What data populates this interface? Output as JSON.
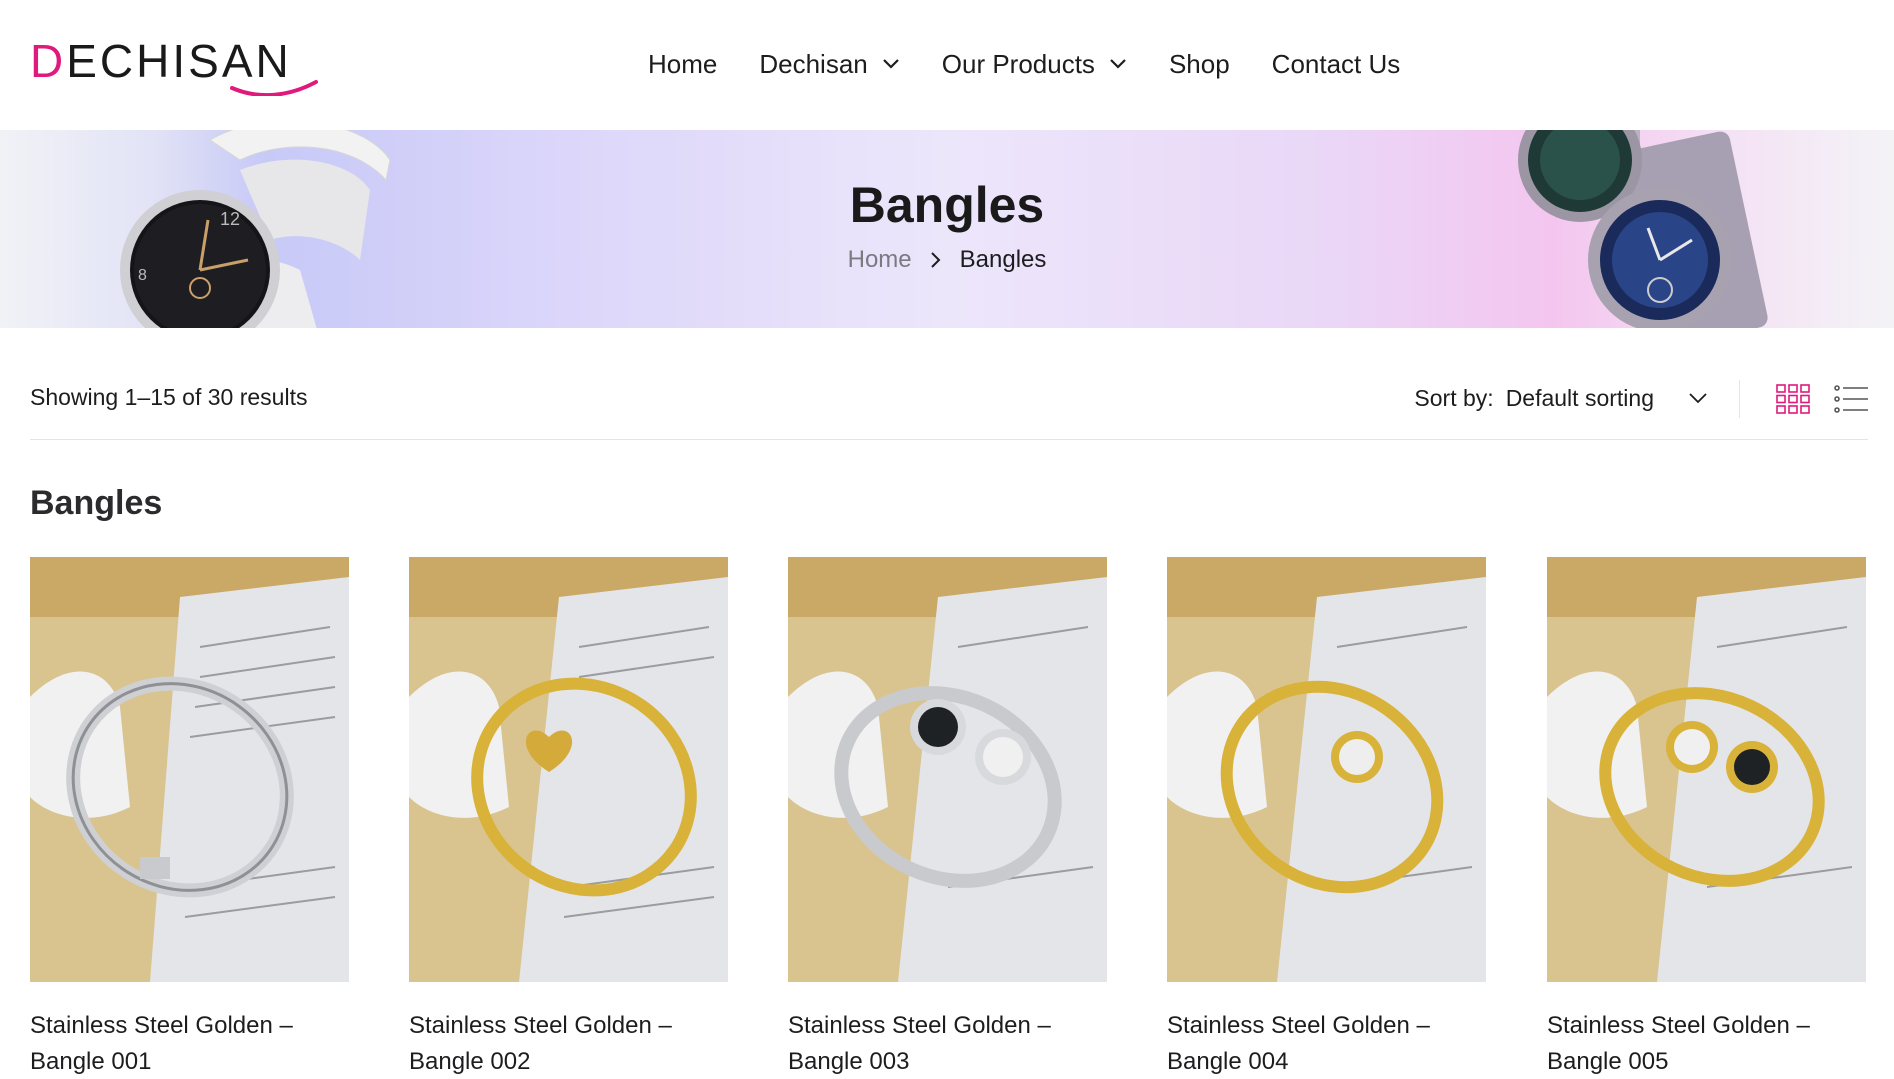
{
  "brand": {
    "logo_text_first": "D",
    "logo_text_e": "E",
    "logo_text_rest": "CHISAN",
    "accent_color": "#e0197d"
  },
  "nav": {
    "items": [
      {
        "label": "Home",
        "has_dropdown": false
      },
      {
        "label": "Dechisan",
        "has_dropdown": true
      },
      {
        "label": "Our Products",
        "has_dropdown": true
      },
      {
        "label": "Shop",
        "has_dropdown": false
      },
      {
        "label": "Contact Us",
        "has_dropdown": false
      }
    ]
  },
  "hero": {
    "title": "Bangles",
    "breadcrumb": {
      "home": "Home",
      "current": "Bangles"
    }
  },
  "toolbar": {
    "result_count": "Showing 1–15 of 30 results",
    "sort_label": "Sort by:",
    "sort_value": "Default sorting",
    "active_view": "grid"
  },
  "section": {
    "title": "Bangles"
  },
  "products": [
    {
      "title_line1": "Stainless Steel Golden –",
      "title_line2": "Bangle 001",
      "metal": "silver"
    },
    {
      "title_line1": "Stainless Steel Golden –",
      "title_line2": "Bangle 002",
      "metal": "gold"
    },
    {
      "title_line1": "Stainless Steel Golden –",
      "title_line2": "Bangle 003",
      "metal": "silver"
    },
    {
      "title_line1": "Stainless Steel Golden –",
      "title_line2": "Bangle 004",
      "metal": "gold"
    },
    {
      "title_line1": "Stainless Steel Golden –",
      "title_line2": "Bangle 005",
      "metal": "gold"
    }
  ]
}
